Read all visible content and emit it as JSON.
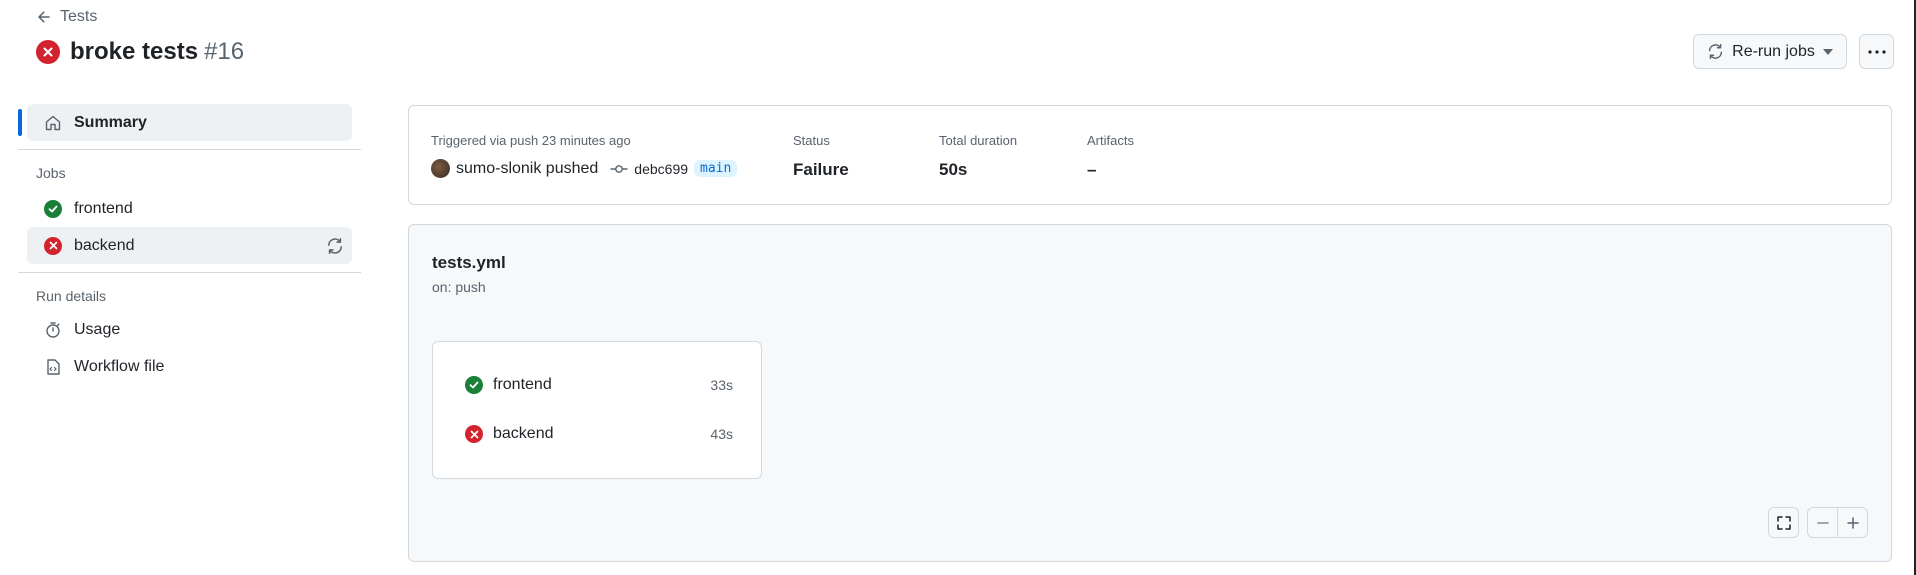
{
  "header": {
    "back_label": "Tests",
    "title": "broke tests",
    "run_number": "#16",
    "rerun_label": "Re-run jobs"
  },
  "sidebar": {
    "summary_label": "Summary",
    "jobs_heading": "Jobs",
    "jobs": [
      {
        "name": "frontend",
        "status": "success"
      },
      {
        "name": "backend",
        "status": "failure"
      }
    ],
    "run_details_heading": "Run details",
    "usage_label": "Usage",
    "workflow_file_label": "Workflow file"
  },
  "summary": {
    "triggered_text": "Triggered via push 23 minutes ago",
    "actor_text": "sumo-slonik pushed",
    "commit_sha": "debc699",
    "branch": "main",
    "status_label": "Status",
    "status_value": "Failure",
    "duration_label": "Total duration",
    "duration_value": "50s",
    "artifacts_label": "Artifacts",
    "artifacts_value": "–"
  },
  "workflow": {
    "file_name": "tests.yml",
    "trigger": "on: push",
    "jobs": [
      {
        "name": "frontend",
        "duration": "33s",
        "status": "success"
      },
      {
        "name": "backend",
        "duration": "43s",
        "status": "failure"
      }
    ]
  },
  "colors": {
    "success": "#1a7f37",
    "failure": "#d1242f",
    "accent": "#0969da"
  }
}
